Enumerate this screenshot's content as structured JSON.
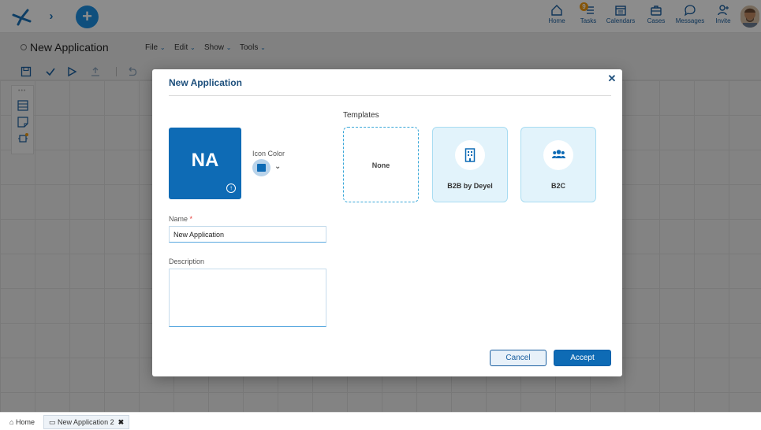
{
  "topbar": {
    "nav": [
      {
        "label": "Home",
        "icon": "home-icon"
      },
      {
        "label": "Tasks",
        "icon": "tasks-icon",
        "badge": "9"
      },
      {
        "label": "Calendars",
        "icon": "calendar-icon"
      },
      {
        "label": "Cases",
        "icon": "briefcase-icon"
      },
      {
        "label": "Messages",
        "icon": "message-icon"
      },
      {
        "label": "Invite",
        "icon": "invite-user-icon"
      }
    ]
  },
  "app": {
    "title": "New Application",
    "menus": [
      {
        "label": "File"
      },
      {
        "label": "Edit"
      },
      {
        "label": "Show"
      },
      {
        "label": "Tools"
      }
    ]
  },
  "dialog": {
    "title": "New Application",
    "icon_abbr": "NA",
    "icon_color_label": "Icon Color",
    "icon_color": "#0e6bb5",
    "name_label": "Name",
    "name_required_mark": "*",
    "name_value": "New Application",
    "description_label": "Description",
    "description_value": "",
    "templates_label": "Templates",
    "templates": [
      {
        "label": "None"
      },
      {
        "label": "B2B by Deyel",
        "icon": "building-icon"
      },
      {
        "label": "B2C",
        "icon": "users-icon"
      }
    ],
    "cancel_label": "Cancel",
    "accept_label": "Accept"
  },
  "bottom_tabs": [
    {
      "label": "Home"
    },
    {
      "label": "New Application 2"
    }
  ],
  "colors": {
    "accent": "#0e6bb5",
    "plus_button": "#1c90e4",
    "template_card": "#e2f3fb"
  }
}
